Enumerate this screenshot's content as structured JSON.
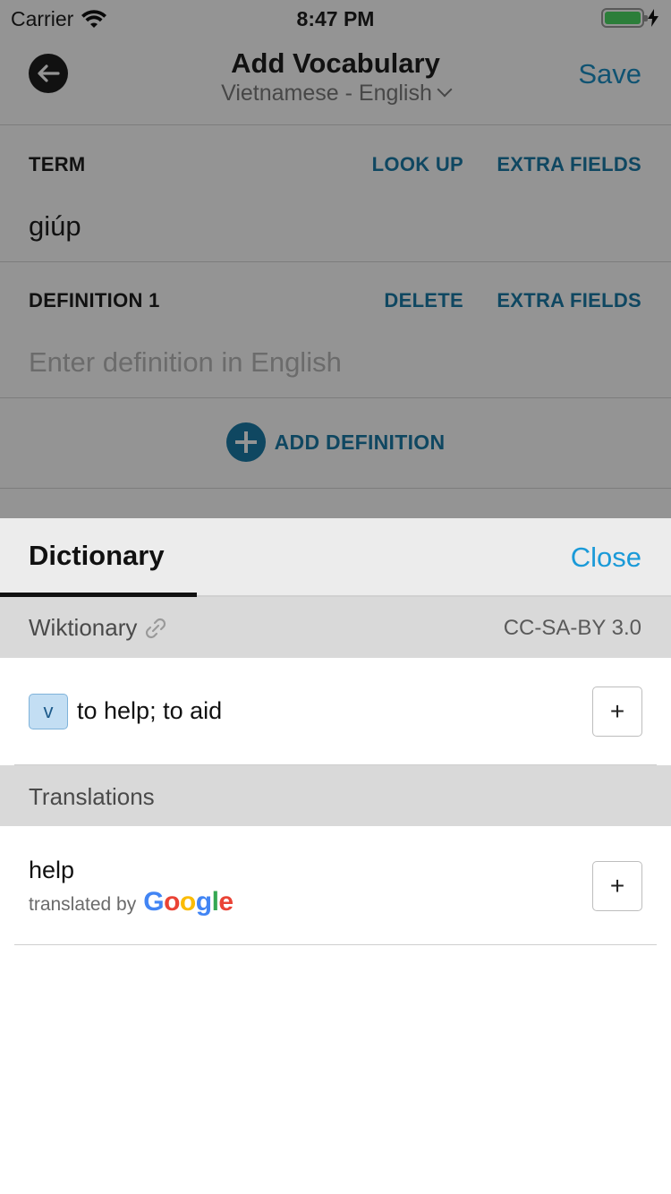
{
  "status_bar": {
    "carrier": "Carrier",
    "time": "8:47 PM"
  },
  "nav": {
    "title": "Add Vocabulary",
    "language_pair": "Vietnamese - English",
    "save_label": "Save"
  },
  "term_field": {
    "label": "TERM",
    "look_up_label": "LOOK UP",
    "extra_fields_label": "EXTRA FIELDS",
    "value": "giúp"
  },
  "definition_field": {
    "label": "DEFINITION 1",
    "delete_label": "DELETE",
    "extra_fields_label": "EXTRA FIELDS",
    "placeholder": "Enter definition in English"
  },
  "add_definition_label": "ADD DEFINITION",
  "dictionary_sheet": {
    "tab_label": "Dictionary",
    "close_label": "Close",
    "wiktionary": {
      "source": "Wiktionary",
      "license": "CC-SA-BY 3.0",
      "entries": [
        {
          "pos": "v",
          "text": "to help; to aid"
        }
      ]
    },
    "translations": {
      "title": "Translations",
      "entries": [
        {
          "text": "help",
          "translated_by": "translated by"
        }
      ]
    },
    "add_button_symbol": "+"
  },
  "colors": {
    "accent": "#1a7aa8",
    "link": "#1a9ad8",
    "battery": "#4cd964",
    "badge_bg": "#c3def3"
  },
  "icons": {
    "back": "arrow-left-icon",
    "link": "link-icon",
    "wifi": "wifi-icon",
    "charging": "bolt-icon",
    "google": "google-logo"
  }
}
